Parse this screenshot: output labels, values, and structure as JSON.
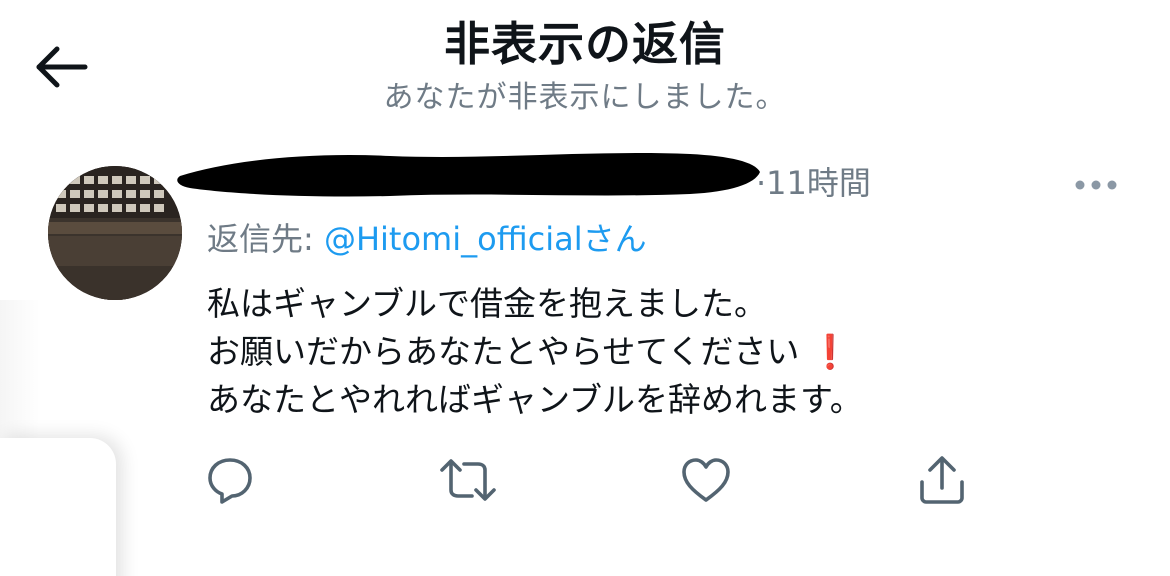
{
  "header": {
    "title": "非表示の返信",
    "subtitle": "あなたが非表示にしました。"
  },
  "tweet": {
    "time": "·11時間",
    "reply_prefix": "返信先: ",
    "reply_handle": "@Hitomi_official",
    "reply_suffix": "さん",
    "lines": [
      "私はギャンブルで借金を抱えました。",
      "お願いだからあなたとやらせてください",
      "あなたとやれればギャンブルを辞めれます。"
    ],
    "emoji": "❗"
  },
  "actions": {
    "reply": "reply-icon",
    "retweet": "retweet-icon",
    "like": "heart-icon",
    "share": "share-icon"
  },
  "colors": {
    "text": "#0f1419",
    "secondary": "#6f7b86",
    "accent": "#1d9bf0",
    "emoji_red": "#e0245e"
  }
}
